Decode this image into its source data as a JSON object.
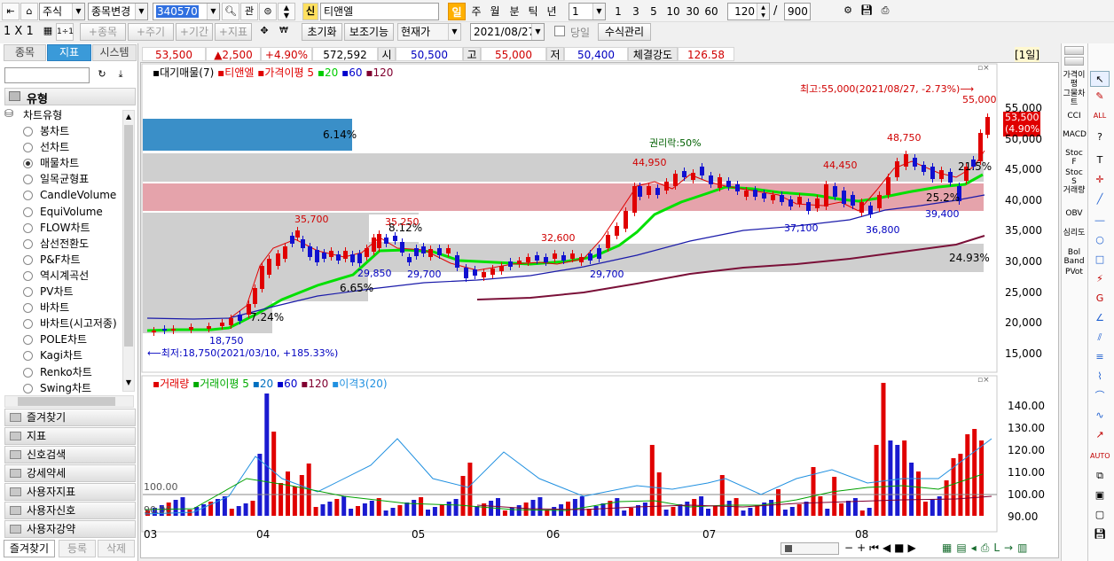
{
  "toolbar1": {
    "market": "주식",
    "code_mode": "종목변경",
    "code": "340570",
    "gwan": "관",
    "stock_badge": "신",
    "stock_name": "티앤엘",
    "periods": [
      "일",
      "주",
      "월",
      "분",
      "틱",
      "년"
    ],
    "count_select": "1",
    "intervals": [
      "1",
      "3",
      "5",
      "10",
      "30",
      "60"
    ],
    "view_count": "120",
    "total_count": "900"
  },
  "toolbar2": {
    "layout": "1 X 1",
    "layout_sub": "1÷1",
    "add_stock": "+종목",
    "add_period": "+주기",
    "add_term": "+기간",
    "add_indicator": "+지표",
    "reset": "초기화",
    "aux": "보조기능",
    "price_type": "현재가",
    "date": "2021/08/27",
    "today_label": "당일",
    "formula": "수식관리"
  },
  "quote": {
    "price": "53,500",
    "change": "▲2,500",
    "change_pct": "+4.90%",
    "volume": "572,592",
    "open_label": "시",
    "open": "50,500",
    "high_label": "고",
    "high": "55,000",
    "low_label": "저",
    "low": "50,400",
    "strength_label": "체결강도",
    "strength": "126.58",
    "period_badge": "[1일]"
  },
  "sidebar": {
    "tabs": [
      "종목",
      "지표",
      "시스템"
    ],
    "active_tab": "지표",
    "section": "유형",
    "group": "차트유형",
    "items": [
      "봉차트",
      "선차트",
      "매물차트",
      "일목균형표",
      "CandleVolume",
      "EquiVolume",
      "FLOW차트",
      "삼선전환도",
      "P&F차트",
      "역시계곡선",
      "PV차트",
      "바차트",
      "바차트(시고저종)",
      "POLE차트",
      "Kagi차트",
      "Renko차트",
      "Swing차트"
    ],
    "selected": "매물차트",
    "accordion": [
      "즐겨찾기",
      "지표",
      "신호검색",
      "강세약세",
      "사용자지표",
      "사용자신호",
      "사용자강약"
    ],
    "bottom_tabs": [
      "즐겨찾기",
      "등록",
      "삭제"
    ]
  },
  "price_chart": {
    "legend": [
      {
        "text": "대기매물(7)",
        "color": "#000000"
      },
      {
        "text": "티앤엘",
        "color": "#e00000"
      },
      {
        "text": "가격이평 5",
        "color": "#e00000"
      },
      {
        "text": "20",
        "color": "#00cc00"
      },
      {
        "text": "60",
        "color": "#0000cc"
      },
      {
        "text": "120",
        "color": "#800030"
      }
    ],
    "max_label": "최고:55,000(2021/08/27, -2.73%)⟶",
    "min_label": "⟵최저:18,750(2021/03/10, +185.33%)",
    "ex_rights": "권리락:50%",
    "price_tag": "53,500",
    "price_tag_pct": "(4.90%)",
    "y_ticks": [
      "55,000",
      "50,000",
      "45,000",
      "40,000",
      "35,000",
      "30,000",
      "25,000",
      "20,000",
      "15,000"
    ],
    "annotations": [
      "35,700",
      "35,250",
      "29,850",
      "29,700",
      "32,600",
      "29,700",
      "44,950",
      "44,450",
      "48,750",
      "37,100",
      "36,800",
      "39,400",
      "18,750",
      "55,000"
    ],
    "volume_profile": [
      {
        "pct": "6.14%",
        "color": "#3a8fc8"
      },
      {
        "pct": "8.12%",
        "color": "#c8c8c8"
      },
      {
        "pct": "24.93%",
        "color": "#c8c8c8"
      },
      {
        "pct": "25.2%",
        "color": "#e8a0a8"
      },
      {
        "pct": "6.65%",
        "color": "#c8c8c8"
      },
      {
        "pct": "21.5%",
        "color": "#c8c8c8"
      },
      {
        "pct": "7.24%",
        "color": "#c8c8c8"
      }
    ]
  },
  "volume_chart": {
    "legend": [
      {
        "text": "거래량",
        "color": "#e00000"
      },
      {
        "text": "거래이평 5",
        "color": "#00aa00"
      },
      {
        "text": "20",
        "color": "#0070c0"
      },
      {
        "text": "60",
        "color": "#0000cc"
      },
      {
        "text": "120",
        "color": "#800030"
      },
      {
        "text": "이격3(20)",
        "color": "#2090e0"
      }
    ],
    "y_ticks": [
      "140.00",
      "130.00",
      "120.00",
      "110.00",
      "100.00",
      "90.00"
    ],
    "inline_labels": [
      "100.00",
      "90.00"
    ]
  },
  "x_axis": [
    "03",
    "04",
    "05",
    "06",
    "07",
    "08"
  ],
  "right_tools": [
    "가격이평",
    "그물차트",
    "CCI",
    "MACD",
    "Stoc F",
    "Stoc S",
    "거래량",
    "OBV",
    "심리도",
    "Bol Band",
    "PVot"
  ]
}
